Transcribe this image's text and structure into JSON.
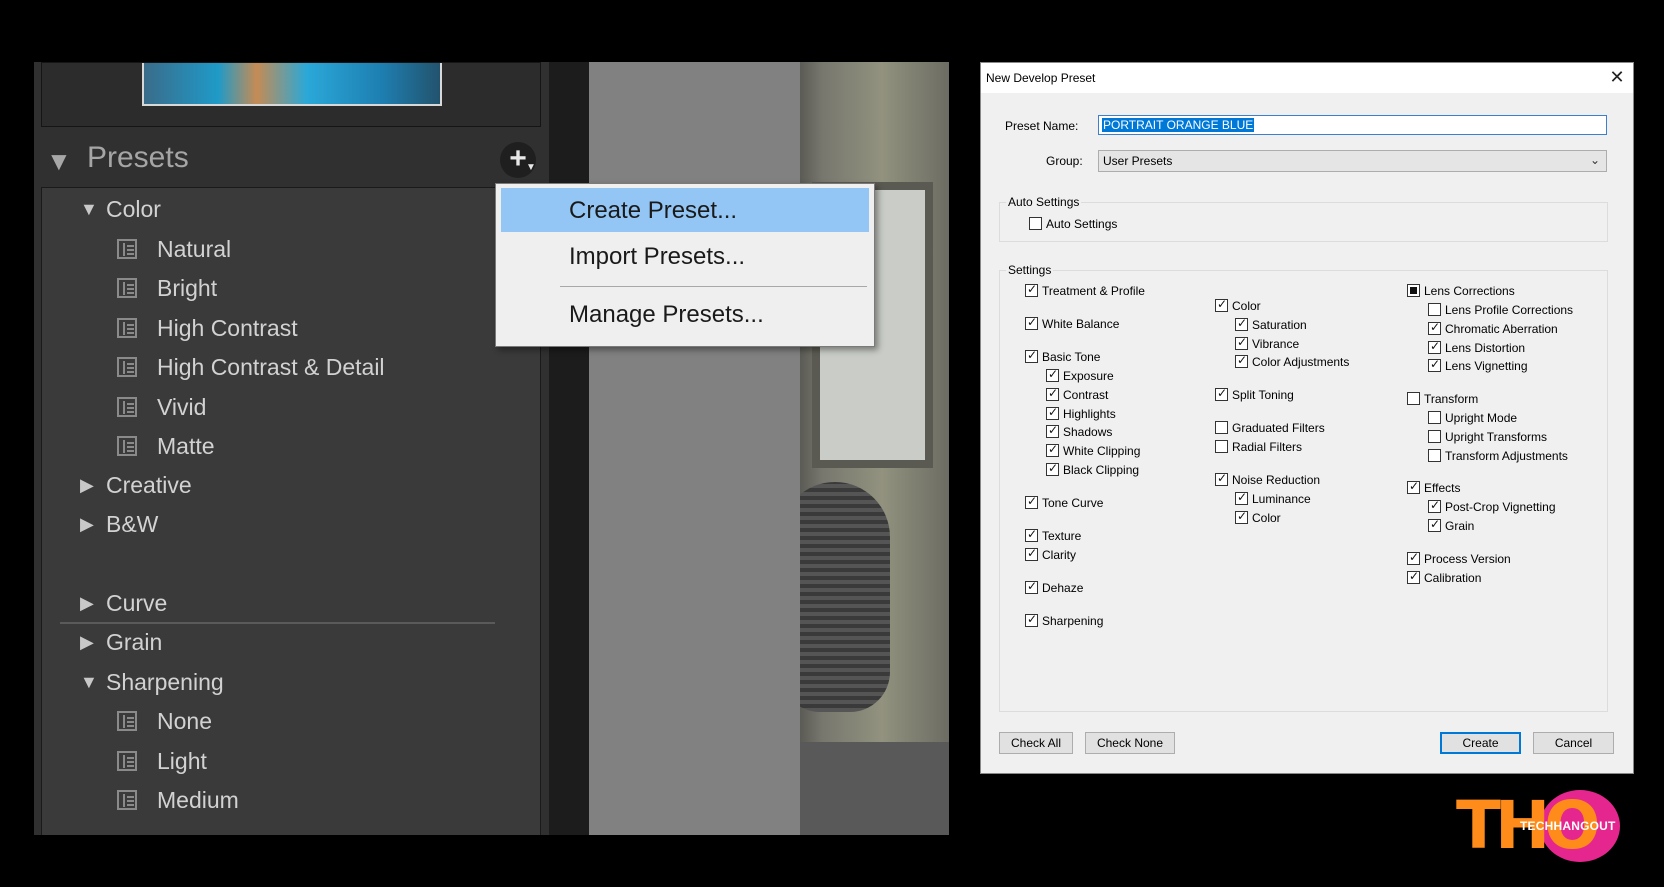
{
  "lightroom": {
    "presets_title": "Presets",
    "plus_button": "+",
    "tree": {
      "color_group": "Color",
      "color_items": [
        "Natural",
        "Bright",
        "High Contrast",
        "High Contrast & Detail",
        "Vivid",
        "Matte"
      ],
      "creative": "Creative",
      "bw": "B&W",
      "curve": "Curve",
      "grain": "Grain",
      "sharpening_group": "Sharpening",
      "sharpening_items": [
        "None",
        "Light",
        "Medium"
      ]
    },
    "context_menu": {
      "create": "Create Preset...",
      "import": "Import Presets...",
      "manage": "Manage Presets..."
    }
  },
  "dialog": {
    "title": "New Develop Preset",
    "close": "✕",
    "preset_name_label": "Preset Name:",
    "preset_name_value": "PORTRAIT ORANGE BLUE",
    "group_label": "Group:",
    "group_value": "User Presets",
    "auto_settings_title": "Auto Settings",
    "auto_settings_checkbox": "Auto Settings",
    "settings_title": "Settings",
    "col1": {
      "treatment": "Treatment & Profile",
      "white_balance": "White Balance",
      "basic_tone": "Basic Tone",
      "exposure": "Exposure",
      "contrast": "Contrast",
      "highlights": "Highlights",
      "shadows": "Shadows",
      "white_clipping": "White Clipping",
      "black_clipping": "Black Clipping",
      "tone_curve": "Tone Curve",
      "texture": "Texture",
      "clarity": "Clarity",
      "dehaze": "Dehaze",
      "sharpening": "Sharpening"
    },
    "col2": {
      "color": "Color",
      "saturation": "Saturation",
      "vibrance": "Vibrance",
      "color_adjustments": "Color Adjustments",
      "split_toning": "Split Toning",
      "graduated_filters": "Graduated Filters",
      "radial_filters": "Radial Filters",
      "noise_reduction": "Noise Reduction",
      "luminance": "Luminance",
      "nr_color": "Color"
    },
    "col3": {
      "lens_corrections": "Lens Corrections",
      "lens_profile": "Lens Profile Corrections",
      "chromatic": "Chromatic Aberration",
      "distortion": "Lens Distortion",
      "vignetting": "Lens Vignetting",
      "transform": "Transform",
      "upright_mode": "Upright Mode",
      "upright_transforms": "Upright Transforms",
      "transform_adjustments": "Transform Adjustments",
      "effects": "Effects",
      "post_crop": "Post-Crop Vignetting",
      "grain": "Grain",
      "process_version": "Process Version",
      "calibration": "Calibration"
    },
    "buttons": {
      "check_all": "Check All",
      "check_none": "Check None",
      "create": "Create",
      "cancel": "Cancel"
    }
  },
  "watermark": {
    "logo_letters": "THO",
    "logo_text": "TECHHANGOUT"
  }
}
